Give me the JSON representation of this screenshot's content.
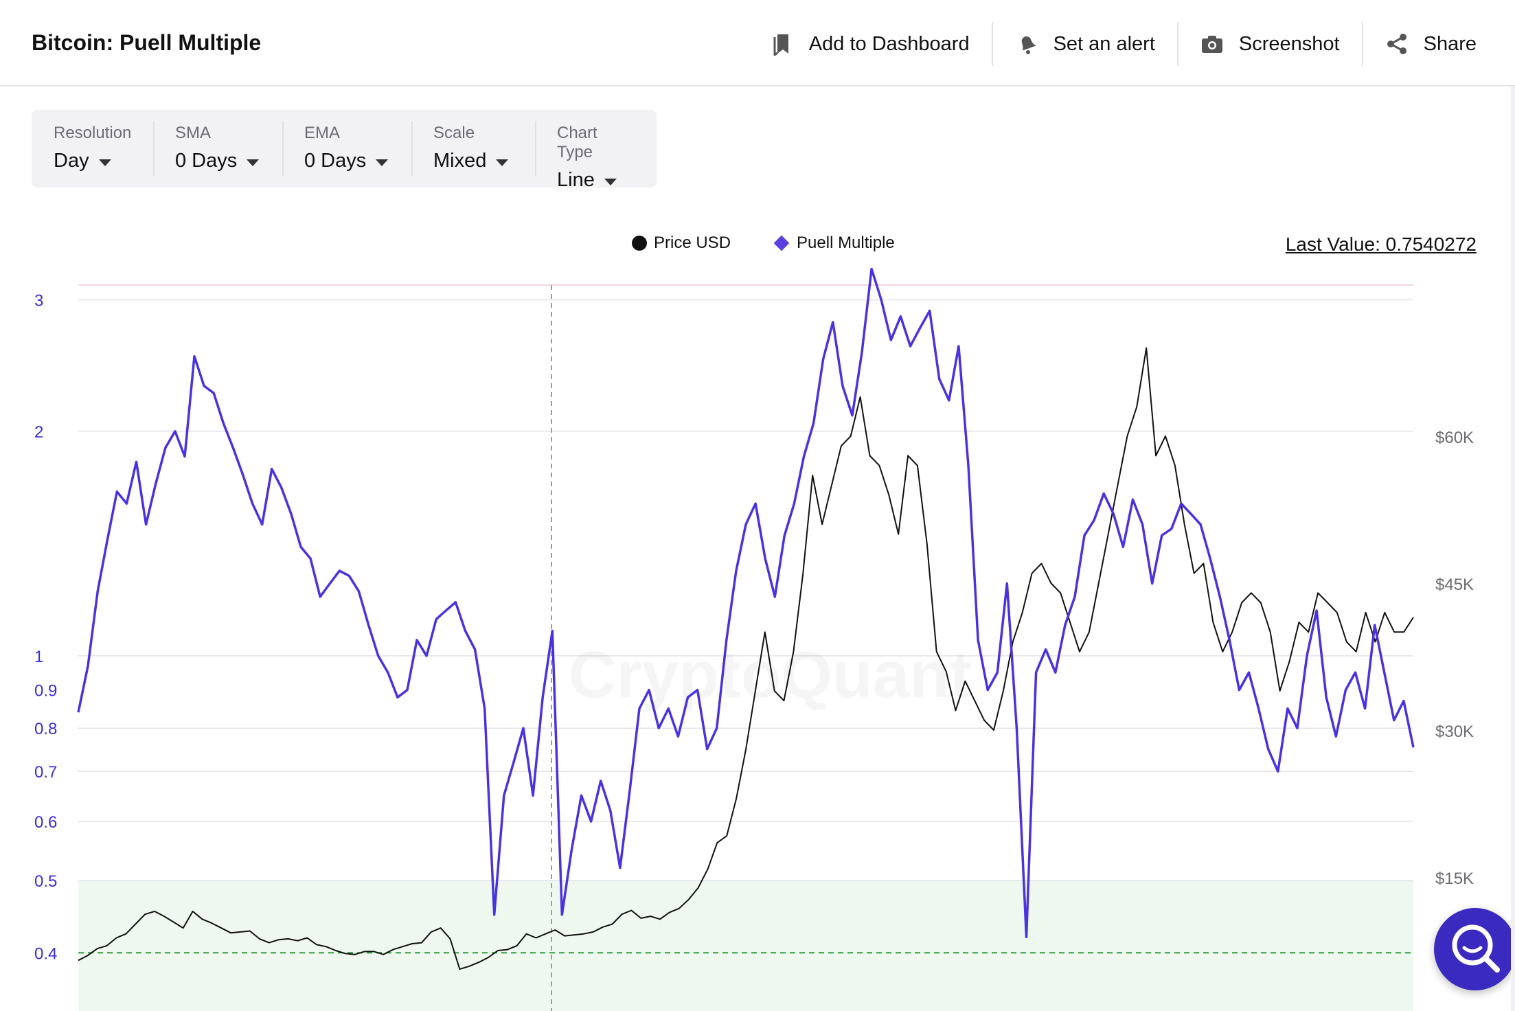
{
  "header": {
    "title": "Bitcoin: Puell Multiple",
    "actions": [
      {
        "label": "Add to Dashboard",
        "icon": "bookmark-icon"
      },
      {
        "label": "Set an alert",
        "icon": "bell-icon"
      },
      {
        "label": "Screenshot",
        "icon": "camera-icon"
      },
      {
        "label": "Share",
        "icon": "share-icon"
      }
    ]
  },
  "controls": [
    {
      "label": "Resolution",
      "value": "Day"
    },
    {
      "label": "SMA",
      "value": "0 Days"
    },
    {
      "label": "EMA",
      "value": "0 Days"
    },
    {
      "label": "Scale",
      "value": "Mixed"
    },
    {
      "label": "Chart Type",
      "value": "Line"
    }
  ],
  "legend": {
    "price": "Price USD",
    "puell": "Puell Multiple"
  },
  "last_value": "Last Value: 0.7540272",
  "watermark": "CryptoQuant",
  "colors": {
    "puell": "#4a32e0",
    "price": "#111111",
    "zone_fill": "#eef8ee",
    "threshold": "#2e9e3e",
    "axis_left": "#3b2fd0",
    "fab": "#3a2ac0"
  },
  "chart_data": {
    "type": "line",
    "scale": "log",
    "left_axis": {
      "ticks": [
        0.4,
        0.5,
        0.6,
        0.7,
        0.8,
        0.9,
        1,
        2,
        3
      ],
      "tick_labels": [
        "0.4",
        "0.5",
        "0.6",
        "0.7",
        "0.8",
        "0.9",
        "1",
        "2",
        "3"
      ]
    },
    "right_axis": {
      "ticks": [
        15000,
        30000,
        45000,
        60000
      ],
      "tick_labels": [
        "$15K",
        "$30K",
        "$45K",
        "$60K"
      ]
    },
    "grid": true,
    "low_zone": {
      "max": 0.5,
      "threshold": 0.4
    },
    "series": [
      {
        "name": "Puell Multiple",
        "axis": "left",
        "values": [
          0.84,
          0.97,
          1.22,
          1.43,
          1.66,
          1.6,
          1.82,
          1.5,
          1.7,
          1.9,
          2.0,
          1.85,
          2.52,
          2.3,
          2.25,
          2.05,
          1.9,
          1.75,
          1.6,
          1.5,
          1.78,
          1.68,
          1.55,
          1.4,
          1.35,
          1.2,
          1.25,
          1.3,
          1.28,
          1.22,
          1.1,
          1.0,
          0.95,
          0.88,
          0.9,
          1.05,
          1.0,
          1.12,
          1.15,
          1.18,
          1.08,
          1.02,
          0.85,
          0.45,
          0.65,
          0.72,
          0.8,
          0.65,
          0.88,
          1.08,
          0.45,
          0.55,
          0.65,
          0.6,
          0.68,
          0.62,
          0.52,
          0.66,
          0.85,
          0.9,
          0.8,
          0.85,
          0.78,
          0.88,
          0.9,
          0.75,
          0.8,
          1.05,
          1.3,
          1.5,
          1.6,
          1.35,
          1.2,
          1.45,
          1.6,
          1.85,
          2.05,
          2.5,
          2.8,
          2.3,
          2.1,
          2.55,
          3.3,
          3.0,
          2.65,
          2.85,
          2.6,
          2.75,
          2.9,
          2.35,
          2.2,
          2.6,
          1.8,
          1.05,
          0.9,
          0.95,
          1.25,
          0.8,
          0.42,
          0.95,
          1.02,
          0.95,
          1.1,
          1.2,
          1.45,
          1.52,
          1.65,
          1.55,
          1.4,
          1.62,
          1.5,
          1.25,
          1.45,
          1.48,
          1.6,
          1.55,
          1.5,
          1.35,
          1.2,
          1.05,
          0.9,
          0.95,
          0.85,
          0.75,
          0.7,
          0.85,
          0.8,
          1.0,
          1.15,
          0.88,
          0.78,
          0.9,
          0.95,
          0.85,
          1.1,
          0.95,
          0.82,
          0.87,
          0.754
        ]
      },
      {
        "name": "Price USD",
        "axis": "right",
        "values": [
          6500,
          7000,
          7700,
          8000,
          8800,
          9200,
          10200,
          11200,
          11500,
          11000,
          10400,
          9800,
          11500,
          10700,
          10300,
          9800,
          9300,
          9400,
          9500,
          8700,
          8300,
          8600,
          8700,
          8500,
          8800,
          8100,
          7900,
          7500,
          7200,
          7100,
          7400,
          7400,
          7100,
          7600,
          7900,
          8200,
          8300,
          9400,
          9800,
          8700,
          5600,
          5900,
          6300,
          6800,
          7500,
          7600,
          8000,
          9200,
          8800,
          9200,
          9600,
          9000,
          9100,
          9200,
          9400,
          9900,
          10200,
          11200,
          11600,
          10800,
          11000,
          10700,
          11400,
          11800,
          12700,
          13900,
          15800,
          18500,
          19200,
          23000,
          28000,
          34000,
          40000,
          34000,
          33000,
          38000,
          46000,
          56000,
          51000,
          55000,
          59000,
          60000,
          64000,
          58000,
          57000,
          54000,
          50000,
          58000,
          57000,
          49000,
          38000,
          36000,
          32000,
          35000,
          33000,
          31000,
          30000,
          34000,
          39000,
          42000,
          46000,
          47000,
          45000,
          44000,
          41000,
          38000,
          40000,
          45000,
          50000,
          55000,
          60000,
          63000,
          69000,
          58000,
          60000,
          57000,
          51000,
          46000,
          47000,
          41000,
          38000,
          40000,
          43000,
          44000,
          43000,
          40000,
          34000,
          37000,
          41000,
          40000,
          44000,
          43000,
          42000,
          39000,
          38000,
          42000,
          39000,
          42000,
          40000,
          40000,
          41500
        ]
      }
    ]
  }
}
